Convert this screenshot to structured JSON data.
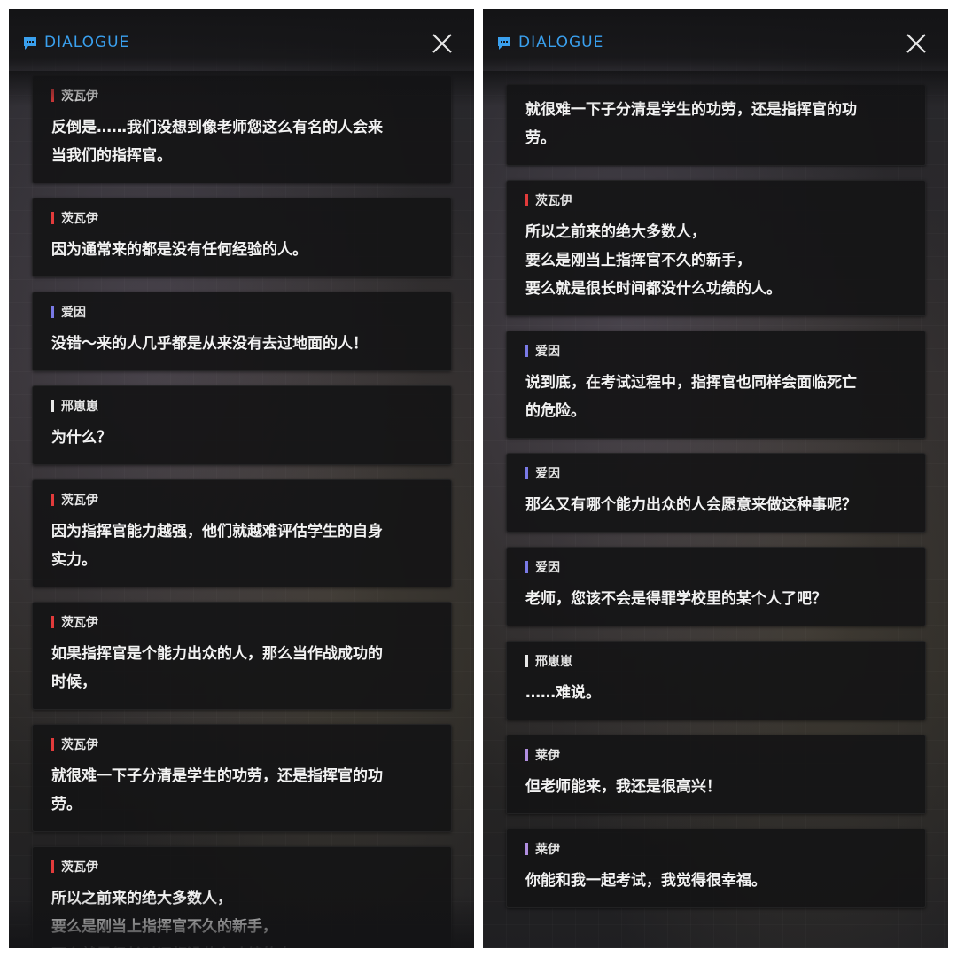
{
  "header": {
    "title": "DIALOGUE"
  },
  "colors": {
    "accent": "#3aa0ee",
    "speakers": {
      "茨瓦伊": "#e23b3b",
      "爱因": "#7a7ae6",
      "邢崽崽": "#e8e8e8",
      "莱伊": "#b08ee0"
    }
  },
  "left": {
    "messages": [
      {
        "speaker": "茨瓦伊",
        "text": "反倒是……我们没想到像老师您这么有名的人会来\n当我们的指挥官。"
      },
      {
        "speaker": "茨瓦伊",
        "text": "因为通常来的都是没有任何经验的人。"
      },
      {
        "speaker": "爱因",
        "text": "没错～来的人几乎都是从来没有去过地面的人！"
      },
      {
        "speaker": "邢崽崽",
        "text": "为什么？"
      },
      {
        "speaker": "茨瓦伊",
        "text": "因为指挥官能力越强，他们就越难评估学生的自身\n实力。"
      },
      {
        "speaker": "茨瓦伊",
        "text": "如果指挥官是个能力出众的人，那么当作战成功的\n时候，"
      },
      {
        "speaker": "茨瓦伊",
        "text": "就很难一下子分清是学生的功劳，还是指挥官的功\n劳。"
      },
      {
        "speaker": "茨瓦伊",
        "text": "所以之前来的绝大多数人，\n要么是刚当上指挥官不久的新手，\n要么就是很长时间都没什么功绩的人。"
      }
    ]
  },
  "right": {
    "messages": [
      {
        "speaker": "",
        "text": "就很难一下子分清是学生的功劳，还是指挥官的功\n劳。"
      },
      {
        "speaker": "茨瓦伊",
        "text": "所以之前来的绝大多数人，\n要么是刚当上指挥官不久的新手，\n要么就是很长时间都没什么功绩的人。"
      },
      {
        "speaker": "爱因",
        "text": "说到底，在考试过程中，指挥官也同样会面临死亡\n的危险。"
      },
      {
        "speaker": "爱因",
        "text": "那么又有哪个能力出众的人会愿意来做这种事呢？"
      },
      {
        "speaker": "爱因",
        "text": "老师，您该不会是得罪学校里的某个人了吧？"
      },
      {
        "speaker": "邢崽崽",
        "text": "……难说。"
      },
      {
        "speaker": "莱伊",
        "text": "但老师能来，我还是很高兴！"
      },
      {
        "speaker": "莱伊",
        "text": "你能和我一起考试，我觉得很幸福。"
      }
    ]
  }
}
